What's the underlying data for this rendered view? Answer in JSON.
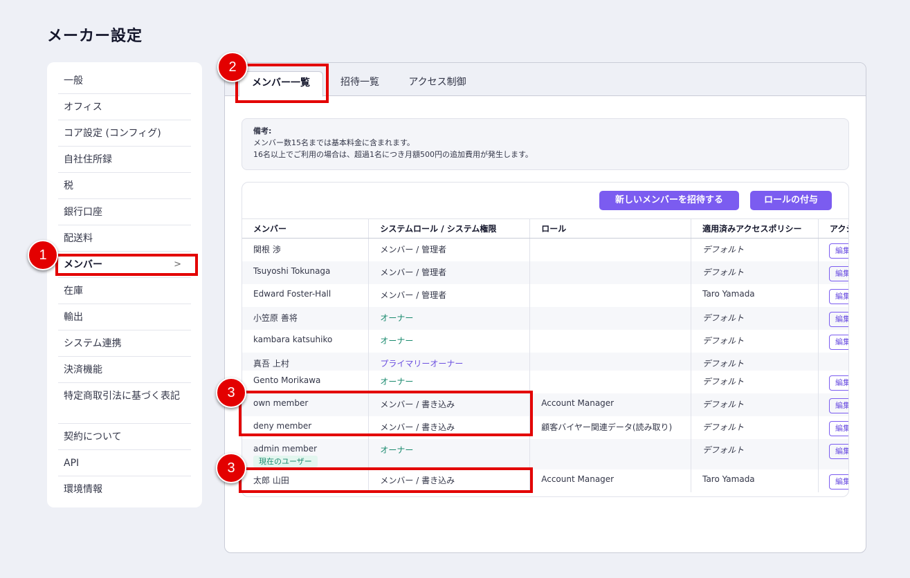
{
  "page": {
    "title": "メーカー設定"
  },
  "sidebar": {
    "items": [
      {
        "label": "一般"
      },
      {
        "label": "オフィス"
      },
      {
        "label": "コア設定 (コンフィグ)"
      },
      {
        "label": "自社住所録"
      },
      {
        "label": "税"
      },
      {
        "label": "銀行口座"
      },
      {
        "label": "配送料"
      },
      {
        "label": "メンバー",
        "chevron": ">"
      },
      {
        "label": "在庫"
      },
      {
        "label": "輸出"
      },
      {
        "label": "システム連携"
      },
      {
        "label": "決済機能"
      },
      {
        "label": "特定商取引法に基づく表記"
      },
      {
        "label": "契約について"
      },
      {
        "label": "API"
      },
      {
        "label": "環境情報"
      }
    ]
  },
  "tabs": [
    {
      "label": "メンバー一覧"
    },
    {
      "label": "招待一覧"
    },
    {
      "label": "アクセス制御"
    }
  ],
  "note": {
    "title": "備考:",
    "line1": "メンバー数15名までは基本料金に含まれます。",
    "line2": "16名以上でご利用の場合は、超過1名につき月額500円の追加費用が発生します。"
  },
  "buttons": {
    "invite": "新しいメンバーを招待する",
    "assign_role": "ロールの付与"
  },
  "table": {
    "headers": [
      "メンバー",
      "システムロール / システム権限",
      "ロール",
      "適用済みアクセスポリシー",
      "アクション"
    ],
    "edit_label": "編集",
    "current_user_badge": "現在のユーザー",
    "rows": [
      {
        "member": "関根 渉",
        "system_role": "メンバー / 管理者",
        "role": "",
        "policy": "デフォルト"
      },
      {
        "member": "Tsuyoshi Tokunaga",
        "system_role": "メンバー / 管理者",
        "role": "",
        "policy": "デフォルト"
      },
      {
        "member": "Edward Foster-Hall",
        "system_role": "メンバー / 管理者",
        "role": "",
        "policy": "Taro Yamada"
      },
      {
        "member": "小笠原 善将",
        "system_role": "オーナー",
        "role": "",
        "policy": "デフォルト"
      },
      {
        "member": "kambara katsuhiko",
        "system_role": "オーナー",
        "role": "",
        "policy": "デフォルト"
      },
      {
        "member": "真吾 上村",
        "system_role": "プライマリーオーナー",
        "role": "",
        "policy": "デフォルト"
      },
      {
        "member": "Gento Morikawa",
        "system_role": "オーナー",
        "role": "",
        "policy": "デフォルト"
      },
      {
        "member": "own member",
        "system_role": "メンバー / 書き込み",
        "role": "Account Manager",
        "policy": "デフォルト"
      },
      {
        "member": "deny member",
        "system_role": "メンバー / 書き込み",
        "role": "顧客バイヤー関連データ(読み取り)",
        "policy": "デフォルト"
      },
      {
        "member": "admin member",
        "system_role": "オーナー",
        "role": "",
        "policy": "デフォルト"
      },
      {
        "member": "太郎 山田",
        "system_role": "メンバー / 書き込み",
        "role": "Account Manager",
        "policy": "Taro Yamada"
      }
    ]
  },
  "annotations": {
    "c1": "1",
    "c2": "2",
    "c3a": "3",
    "c3b": "3"
  },
  "colors": {
    "accent": "#7b5cf0",
    "annotation_red": "#e30000",
    "owner_green": "#1a8a6e"
  }
}
